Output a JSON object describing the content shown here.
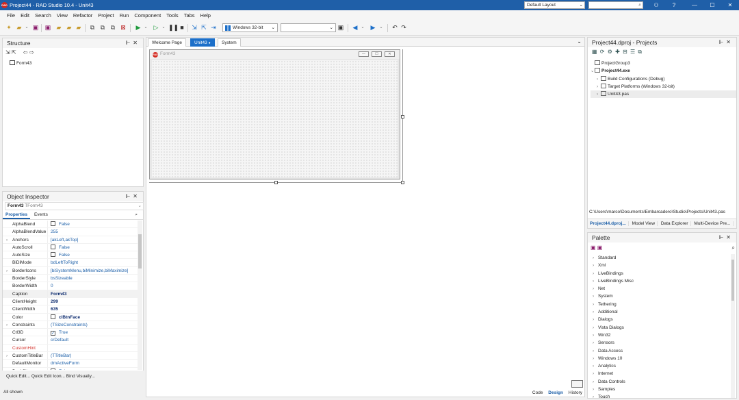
{
  "app": {
    "title": "Project44 - RAD Studio 10.4 - Unit43",
    "logo": "RAD",
    "layout_combo": "Default Layout",
    "window_controls": [
      "—",
      "☐",
      "✕"
    ]
  },
  "menu": [
    "File",
    "Edit",
    "Search",
    "View",
    "Refactor",
    "Project",
    "Run",
    "Component",
    "Tools",
    "Tabs",
    "Help"
  ],
  "toolbar": {
    "platform": "Windows 32-bit",
    "config": ""
  },
  "structure": {
    "title": "Structure",
    "tree": [
      "Form43"
    ]
  },
  "inspector": {
    "title": "Object Inspector",
    "selected_name": "Form43",
    "selected_type": "TForm43",
    "tabs": [
      "Properties",
      "Events"
    ],
    "properties": [
      {
        "name": "AlphaBlend",
        "value": "False",
        "chk": "off"
      },
      {
        "name": "AlphaBlendValue",
        "value": "255"
      },
      {
        "name": "Anchors",
        "value": "[akLeft,akTop]",
        "expand": true
      },
      {
        "name": "AutoScroll",
        "value": "False",
        "chk": "off"
      },
      {
        "name": "AutoSize",
        "value": "False",
        "chk": "off"
      },
      {
        "name": "BiDiMode",
        "value": "bdLeftToRight"
      },
      {
        "name": "BorderIcons",
        "value": "[biSystemMenu,biMinimize,biMaximize]",
        "expand": true
      },
      {
        "name": "BorderStyle",
        "value": "bsSizeable"
      },
      {
        "name": "BorderWidth",
        "value": "0"
      },
      {
        "name": "Caption",
        "value": "Form43",
        "bold": true,
        "selected": true
      },
      {
        "name": "ClientHeight",
        "value": "299",
        "bold": true
      },
      {
        "name": "ClientWidth",
        "value": "635",
        "bold": true
      },
      {
        "name": "Color",
        "value": "clBtnFace",
        "bold": true,
        "chk": "off"
      },
      {
        "name": "Constraints",
        "value": "(TSizeConstraints)",
        "expand": true
      },
      {
        "name": "Ctl3D",
        "value": "True",
        "chk": "on"
      },
      {
        "name": "Cursor",
        "value": "crDefault"
      },
      {
        "name": "CustomHint",
        "value": "",
        "red": true
      },
      {
        "name": "CustomTitleBar",
        "value": "(TTitleBar)",
        "expand": true
      },
      {
        "name": "DefaultMonitor",
        "value": "dmActiveForm"
      },
      {
        "name": "DockSite",
        "value": "False",
        "chk": "off"
      }
    ],
    "quick_edit": "Quick Edit...  Quick Edit Icon...  Bind Visually...",
    "status": "All shown"
  },
  "editor": {
    "tabs": [
      "Welcome Page",
      "Unit43",
      "System"
    ],
    "active_tab": "Unit43",
    "form_caption": "Form43",
    "bottom_tabs": [
      "Code",
      "Design",
      "History"
    ]
  },
  "projects": {
    "title": "Project44.dproj - Projects",
    "tree": [
      {
        "label": "ProjectGroup3",
        "indent": 0,
        "toggle": ""
      },
      {
        "label": "Project44.exe",
        "indent": 0,
        "toggle": "⌄",
        "bold": true
      },
      {
        "label": "Build Configurations (Debug)",
        "indent": 1,
        "toggle": "›"
      },
      {
        "label": "Target Platforms (Windows 32-bit)",
        "indent": 1,
        "toggle": "›"
      },
      {
        "label": "Unit43.pas",
        "indent": 1,
        "toggle": "›"
      }
    ],
    "path": "C:\\Users\\marco\\Documents\\Embarcadero\\Studio\\Projects\\Unit43.pas",
    "tabs": [
      "Project44.dproj...",
      "Model View",
      "Data Explorer",
      "Multi-Device Pre..."
    ]
  },
  "palette": {
    "title": "Palette",
    "items": [
      "Standard",
      "Xml",
      "LiveBindings",
      "LiveBindings Misc",
      "Net",
      "System",
      "Tethering",
      "Additional",
      "Dialogs",
      "Vista Dialogs",
      "Win32",
      "Sensors",
      "Data Access",
      "Windows 10",
      "Analytics",
      "Internet",
      "Data Controls",
      "Samples",
      "Touch"
    ]
  }
}
